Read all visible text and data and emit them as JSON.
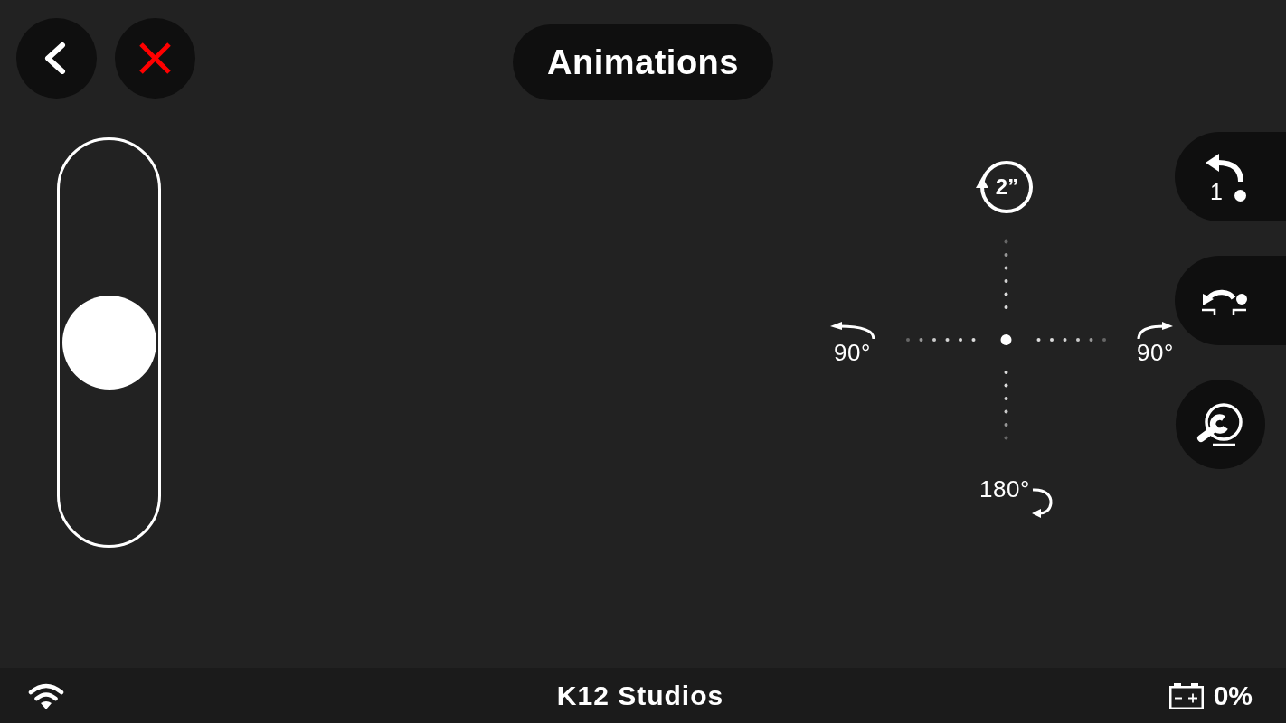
{
  "header": {
    "title": "Animations"
  },
  "speed_slider": {
    "level": 0.5
  },
  "rotation_pad": {
    "spin": {
      "label": "2”"
    },
    "turn_left": {
      "label": "90°"
    },
    "turn_right": {
      "label": "90°"
    },
    "turn_around": {
      "label": "180°"
    }
  },
  "side_buttons": [
    {
      "kind": "replay",
      "label": "1"
    },
    {
      "kind": "turn"
    },
    {
      "kind": "tools"
    }
  ],
  "status_bar": {
    "title": "K12 Studios",
    "battery": "0%"
  }
}
